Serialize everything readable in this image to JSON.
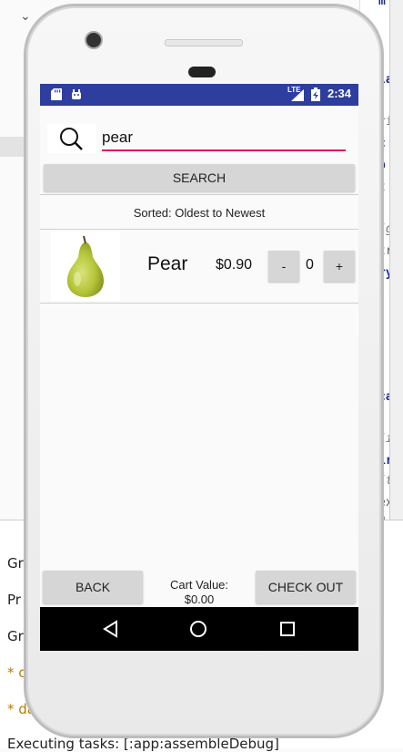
{
  "ide": {
    "right_code": [
      "m",
      "la",
      "ri",
      "c",
      "p",
      "t",
      "/g",
      "tr",
      "ry",
      "ca",
      "/i",
      "ir",
      "/t",
      "ex",
      "h"
    ],
    "bottom_lines": [
      "Gr",
      "Pr",
      "Gr",
      "* c",
      "* da",
      "Executing tasks: [:app:assembleDebug]"
    ]
  },
  "statusbar": {
    "time": "2:34",
    "network_label": "LTE"
  },
  "search": {
    "value": "pear",
    "button_label": "SEARCH"
  },
  "sort": {
    "label": "Sorted: Oldest to Newest"
  },
  "items": [
    {
      "name": "Pear",
      "price": "$0.90",
      "quantity": "0",
      "minus_label": "-",
      "plus_label": "+",
      "image_icon": "pear-icon"
    }
  ],
  "footer": {
    "back_label": "BACK",
    "cart_label": "Cart Value:",
    "cart_value": "$0.00",
    "checkout_label": "CHECK OUT"
  },
  "colors": {
    "statusbar": "#2d3e9f",
    "accent": "#d81b60",
    "button": "#d6d6d6"
  }
}
